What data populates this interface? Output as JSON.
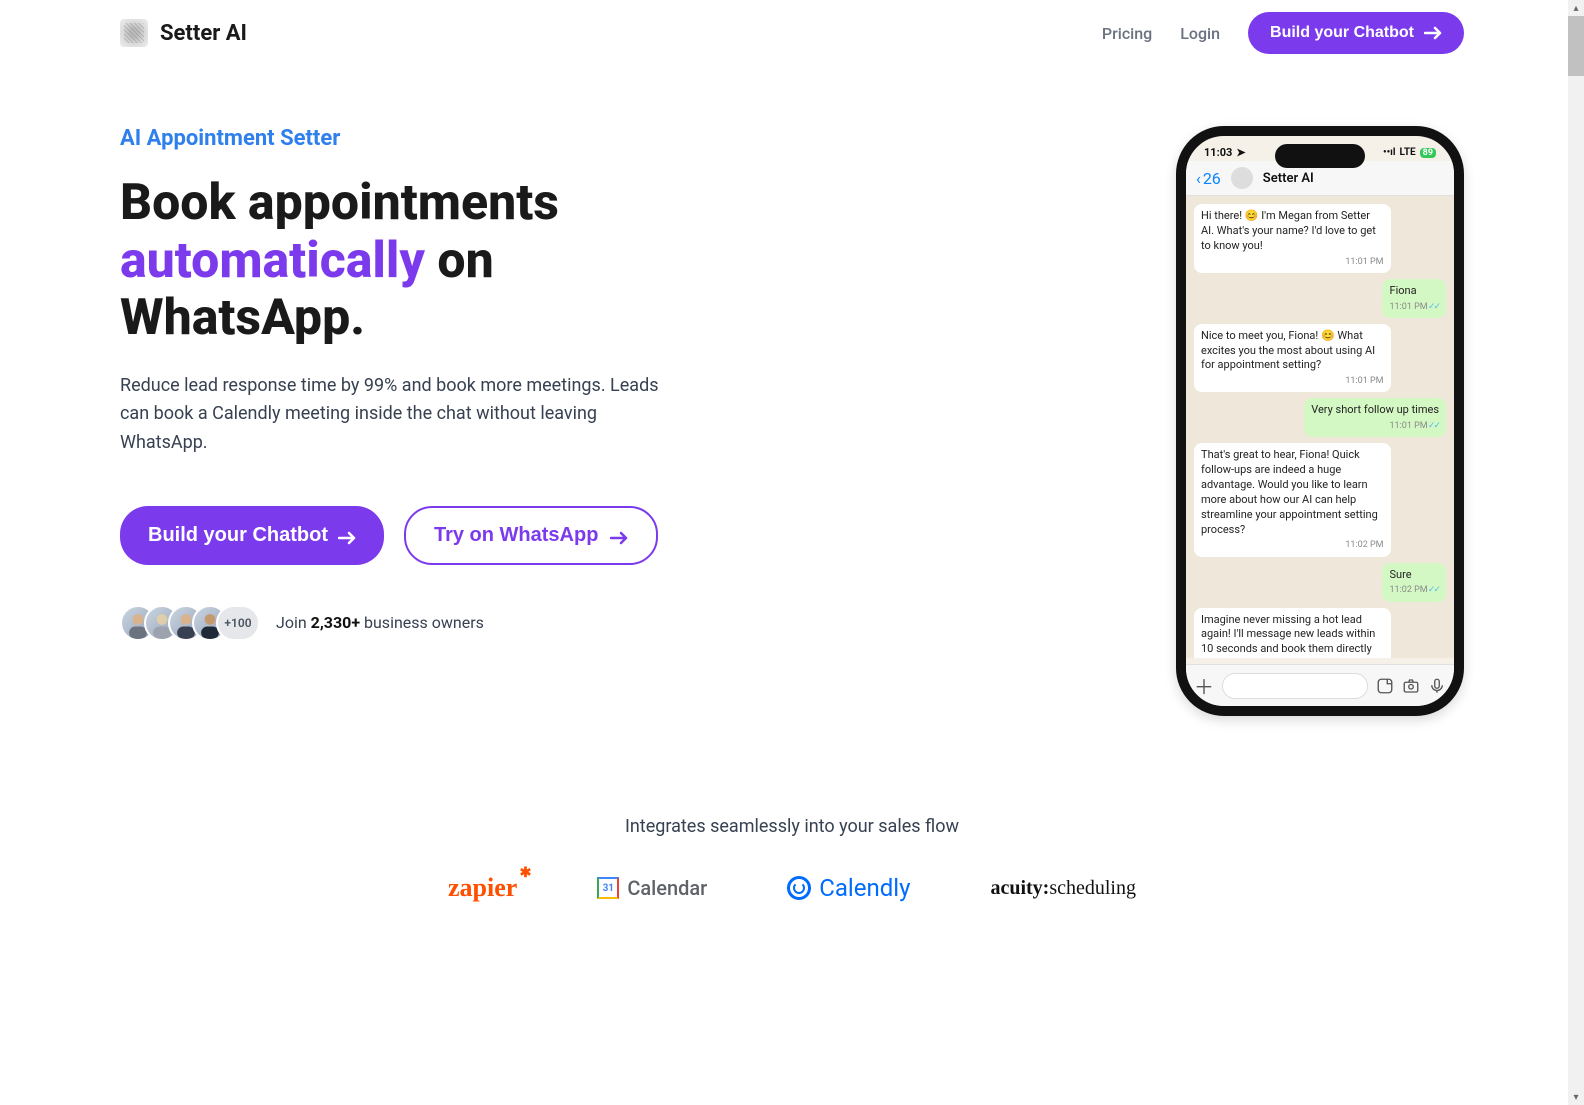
{
  "nav": {
    "brand": "Setter AI",
    "links": {
      "pricing": "Pricing",
      "login": "Login"
    },
    "cta": "Build your Chatbot"
  },
  "hero": {
    "eyebrow": "AI Appointment Setter",
    "headline_part1": "Book appointments ",
    "headline_accent": "automatically",
    "headline_part2": " on WhatsApp.",
    "sub": "Reduce lead response time by 99% and book more meetings. Leads can book a Calendly meeting inside the chat without leaving WhatsApp.",
    "cta_primary": "Build your Chatbot",
    "cta_secondary": "Try on WhatsApp",
    "avatar_more": "+100",
    "social_before": "Join ",
    "social_count": "2,330+",
    "social_after": " business owners"
  },
  "phone": {
    "time": "11:03",
    "carrier": "LTE",
    "battery": "89",
    "back_count": "26",
    "chat_name": "Setter AI",
    "messages": [
      {
        "dir": "in",
        "text": "Hi there! 😊 I'm Megan from Setter AI. What's your name? I'd love to get to know you!",
        "ts": "11:01 PM"
      },
      {
        "dir": "out",
        "text": "Fiona",
        "ts": "11:01 PM"
      },
      {
        "dir": "in",
        "text": "Nice to meet you, Fiona! 😊 What excites you the most about using AI for appointment setting?",
        "ts": "11:01 PM"
      },
      {
        "dir": "out",
        "text": "Very short follow up times",
        "ts": "11:01 PM"
      },
      {
        "dir": "in",
        "text": "That's great to hear, Fiona! Quick follow-ups are indeed a huge advantage. Would you like to learn more about how our AI can help streamline your appointment setting process?",
        "ts": "11:02 PM"
      },
      {
        "dir": "out",
        "text": "Sure",
        "ts": "11:02 PM"
      },
      {
        "dir": "in",
        "text": "Imagine never missing a hot lead again! I'll message new leads within 10 seconds and book them directly into your Calendly, all while you focus on what you do best. I'm here for you 24/7! How about we hop on a live demo to show you",
        "ts": ""
      }
    ]
  },
  "integrations": {
    "title": "Integrates seamlessly into your sales flow",
    "zapier": "zapier",
    "gcal_num": "31",
    "gcal_text": "Calendar",
    "calendly": "Calendly",
    "acuity_a": "acuity:",
    "acuity_b": "scheduling"
  }
}
